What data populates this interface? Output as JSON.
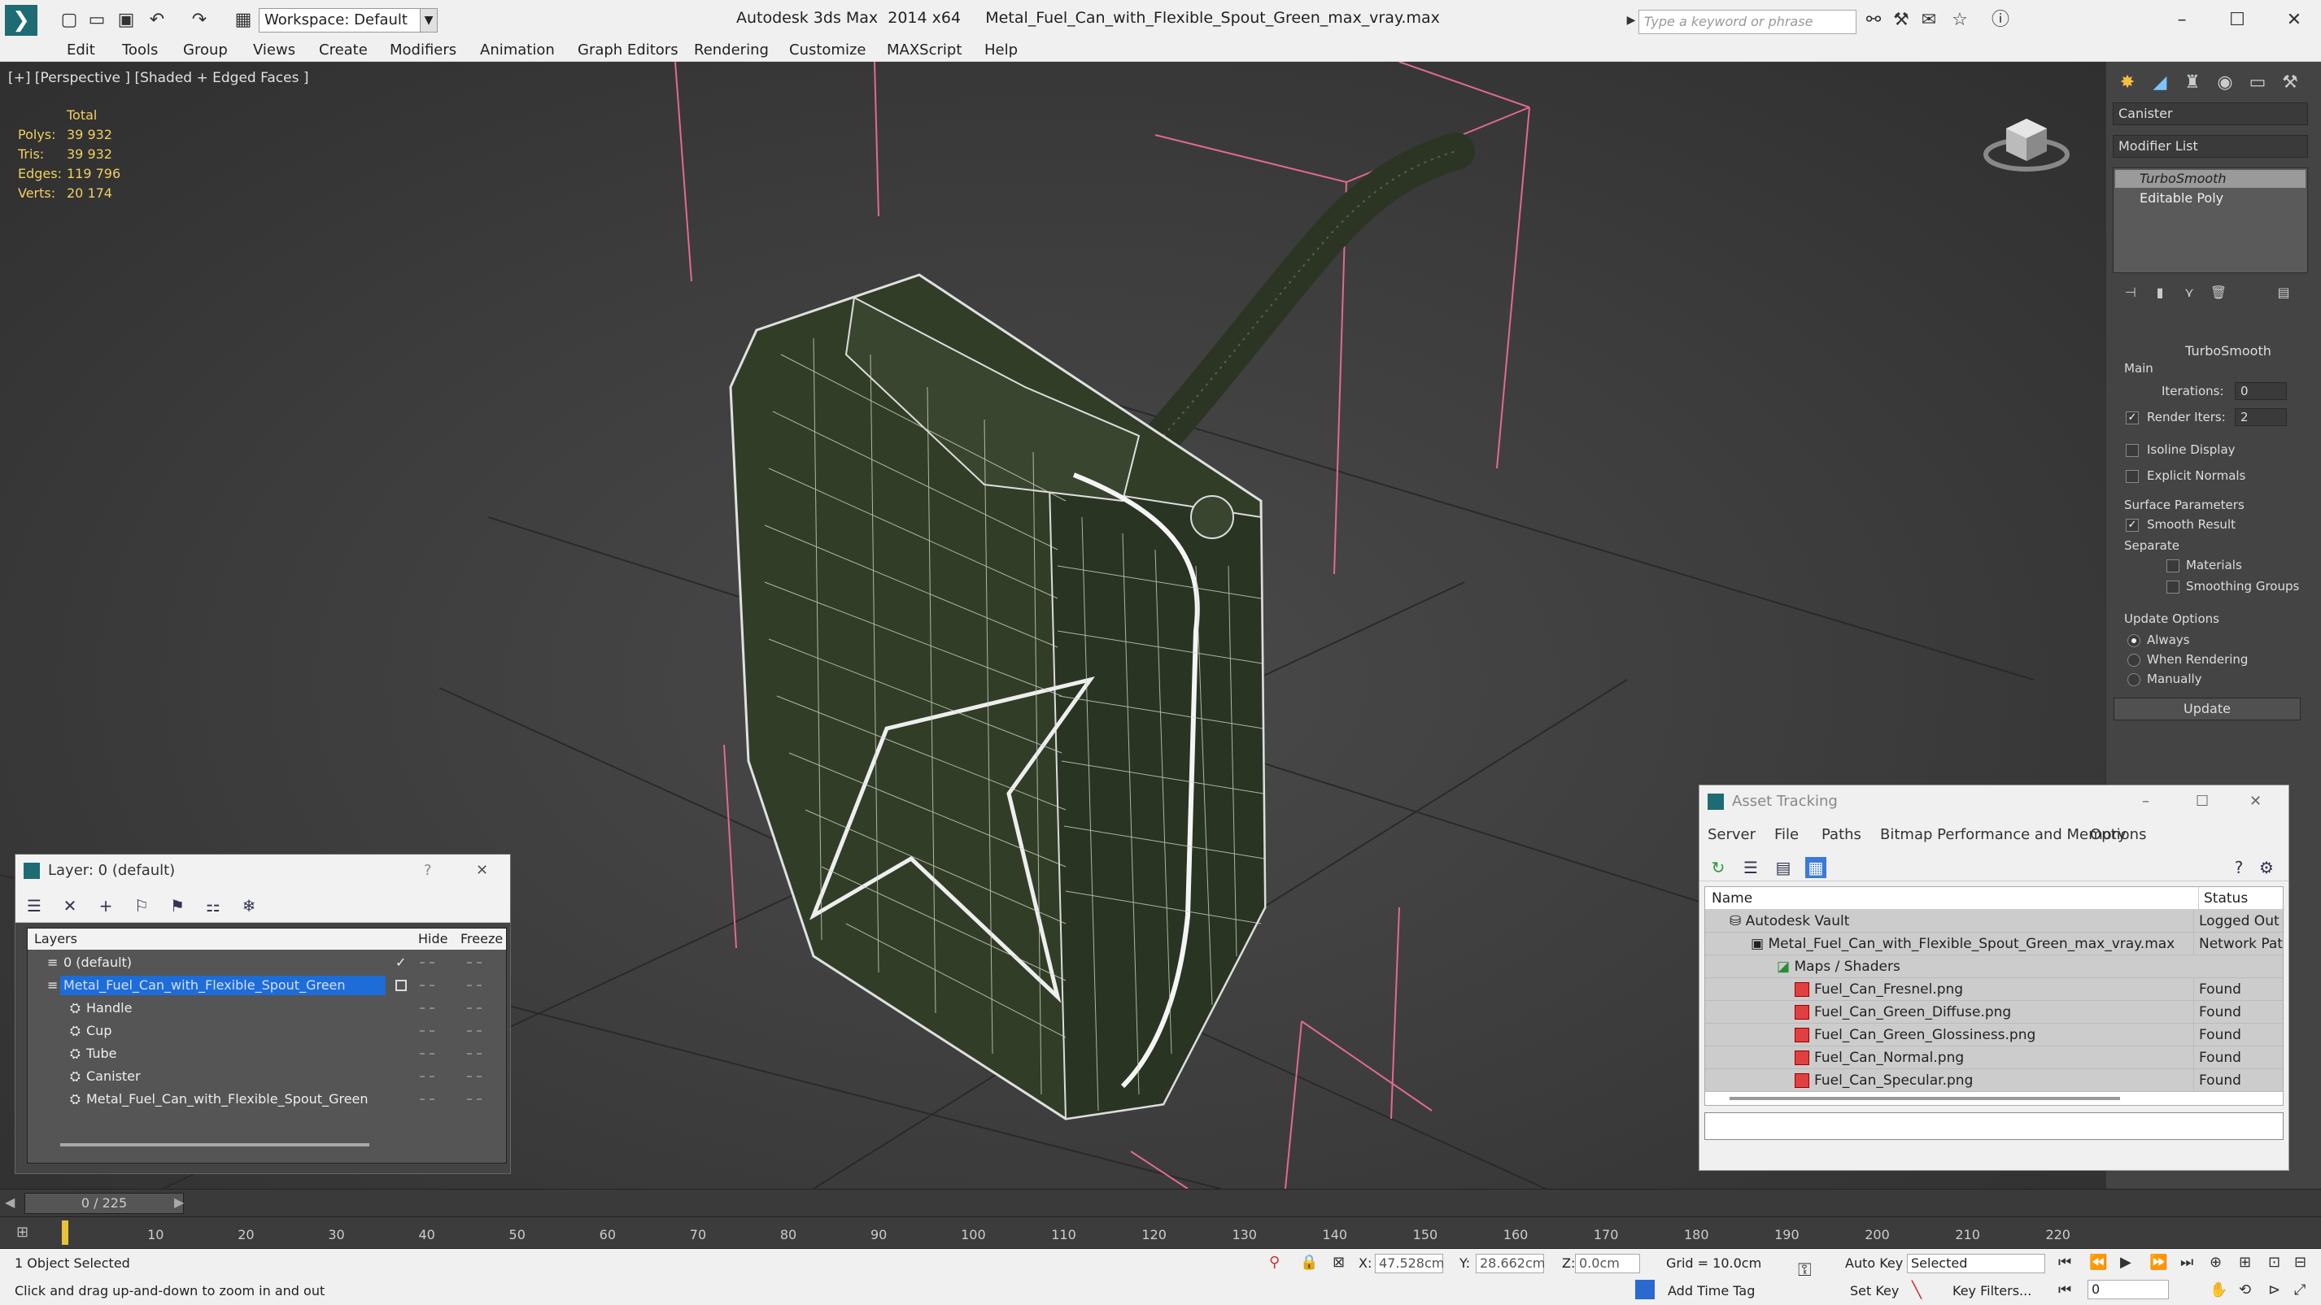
{
  "titlebar": {
    "workspace": "Workspace: Default",
    "app_name": "Autodesk 3ds Max  2014 x64",
    "file_name": "Metal_Fuel_Can_with_Flexible_Spout_Green_max_vray.max",
    "search_placeholder": "Type a keyword or phrase"
  },
  "menu": [
    "Edit",
    "Tools",
    "Group",
    "Views",
    "Create",
    "Modifiers",
    "Animation",
    "Graph Editors",
    "Rendering",
    "Customize",
    "MAXScript",
    "Help"
  ],
  "viewport": {
    "label": "[+] [Perspective ] [Shaded + Edged Faces ]",
    "stats": {
      "total_label": "Total",
      "polys_label": "Polys:",
      "polys": "39 932",
      "tris_label": "Tris:",
      "tris": "39 932",
      "edges_label": "Edges:",
      "edges": "119 796",
      "verts_label": "Verts:",
      "verts": "20 174"
    }
  },
  "command_panel": {
    "object_name": "Canister",
    "modifier_list": "Modifier List",
    "stack": [
      "TurboSmooth",
      "Editable Poly"
    ],
    "rollout_title": "TurboSmooth",
    "main_label": "Main",
    "iterations_label": "Iterations:",
    "iterations": "0",
    "render_iters_label": "Render Iters:",
    "render_iters": "2",
    "isoline": "Isoline Display",
    "explicit_normals": "Explicit Normals",
    "surface_params": "Surface Parameters",
    "smooth_result": "Smooth Result",
    "separate": "Separate",
    "materials": "Materials",
    "smoothing_groups": "Smoothing Groups",
    "update_options": "Update Options",
    "always": "Always",
    "when_rendering": "When Rendering",
    "manually": "Manually",
    "update_btn": "Update"
  },
  "layer_panel": {
    "title": "Layer: 0 (default)",
    "help": "?",
    "col_layers": "Layers",
    "col_hide": "Hide",
    "col_freeze": "Freeze",
    "rows": [
      {
        "name": "0 (default)",
        "indent": 0
      },
      {
        "name": "Metal_Fuel_Can_with_Flexible_Spout_Green",
        "indent": 0,
        "selected": true
      },
      {
        "name": "Handle",
        "indent": 1
      },
      {
        "name": "Cup",
        "indent": 1
      },
      {
        "name": "Tube",
        "indent": 1
      },
      {
        "name": "Canister",
        "indent": 1
      },
      {
        "name": "Metal_Fuel_Can_with_Flexible_Spout_Green",
        "indent": 1
      }
    ]
  },
  "asset_tracking": {
    "title": "Asset Tracking",
    "menu": [
      "Server",
      "File",
      "Paths",
      "Bitmap Performance and Memory",
      "Options"
    ],
    "col_name": "Name",
    "col_status": "Status",
    "rows": [
      {
        "name": "Autodesk Vault",
        "status": "Logged Out ...",
        "indent": 1
      },
      {
        "name": "Metal_Fuel_Can_with_Flexible_Spout_Green_max_vray.max",
        "status": "Network Path",
        "indent": 2
      },
      {
        "name": "Maps / Shaders",
        "status": "",
        "indent": 3
      },
      {
        "name": "Fuel_Can_Fresnel.png",
        "status": "Found",
        "indent": 4
      },
      {
        "name": "Fuel_Can_Green_Diffuse.png",
        "status": "Found",
        "indent": 4
      },
      {
        "name": "Fuel_Can_Green_Glossiness.png",
        "status": "Found",
        "indent": 4
      },
      {
        "name": "Fuel_Can_Normal.png",
        "status": "Found",
        "indent": 4
      },
      {
        "name": "Fuel_Can_Specular.png",
        "status": "Found",
        "indent": 4
      }
    ]
  },
  "timeline": {
    "frame": "0 / 225",
    "ticks": [
      "10",
      "20",
      "30",
      "40",
      "50",
      "60",
      "70",
      "80",
      "90",
      "100",
      "110",
      "120",
      "130",
      "140",
      "150",
      "160",
      "170",
      "180",
      "190",
      "200",
      "210",
      "220"
    ]
  },
  "status": {
    "selection": "1 Object Selected",
    "hint": "Click and drag up-and-down to zoom in and out",
    "x_label": "X:",
    "x": "47.528cm",
    "y_label": "Y:",
    "y": "28.662cm",
    "z_label": "Z:",
    "z": "0.0cm",
    "grid": "Grid = 10.0cm",
    "auto_key": "Auto Key",
    "selected": "Selected",
    "set_key": "Set Key",
    "key_filters": "Key Filters...",
    "add_time_tag": "Add Time Tag",
    "frame_field": "0"
  }
}
